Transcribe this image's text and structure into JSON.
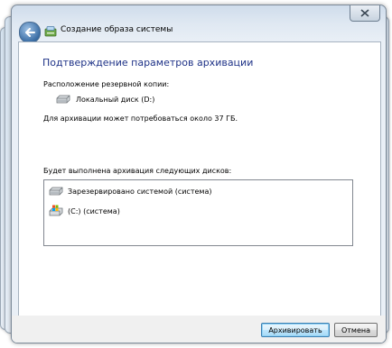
{
  "window": {
    "title": "Создание образа системы"
  },
  "page": {
    "heading": "Подтверждение параметров архивации",
    "location_label": "Расположение резервной копии:",
    "location_value": "Локальный диск (D:)",
    "size_note": "Для архивации может потребоваться около 37 ГБ.",
    "disks_label": "Будет выполнена архивация следующих дисков:",
    "disks": [
      {
        "label": "Зарезервировано системой (система)",
        "icon": "drive-icon"
      },
      {
        "label": "(C:) (система)",
        "icon": "windows-drive-icon"
      }
    ]
  },
  "buttons": {
    "archive": "Архивировать",
    "cancel": "Отмена"
  },
  "colors": {
    "heading": "#1e3287",
    "chrome": "#dfe8f2",
    "default_button_border": "#3c7fb1"
  }
}
